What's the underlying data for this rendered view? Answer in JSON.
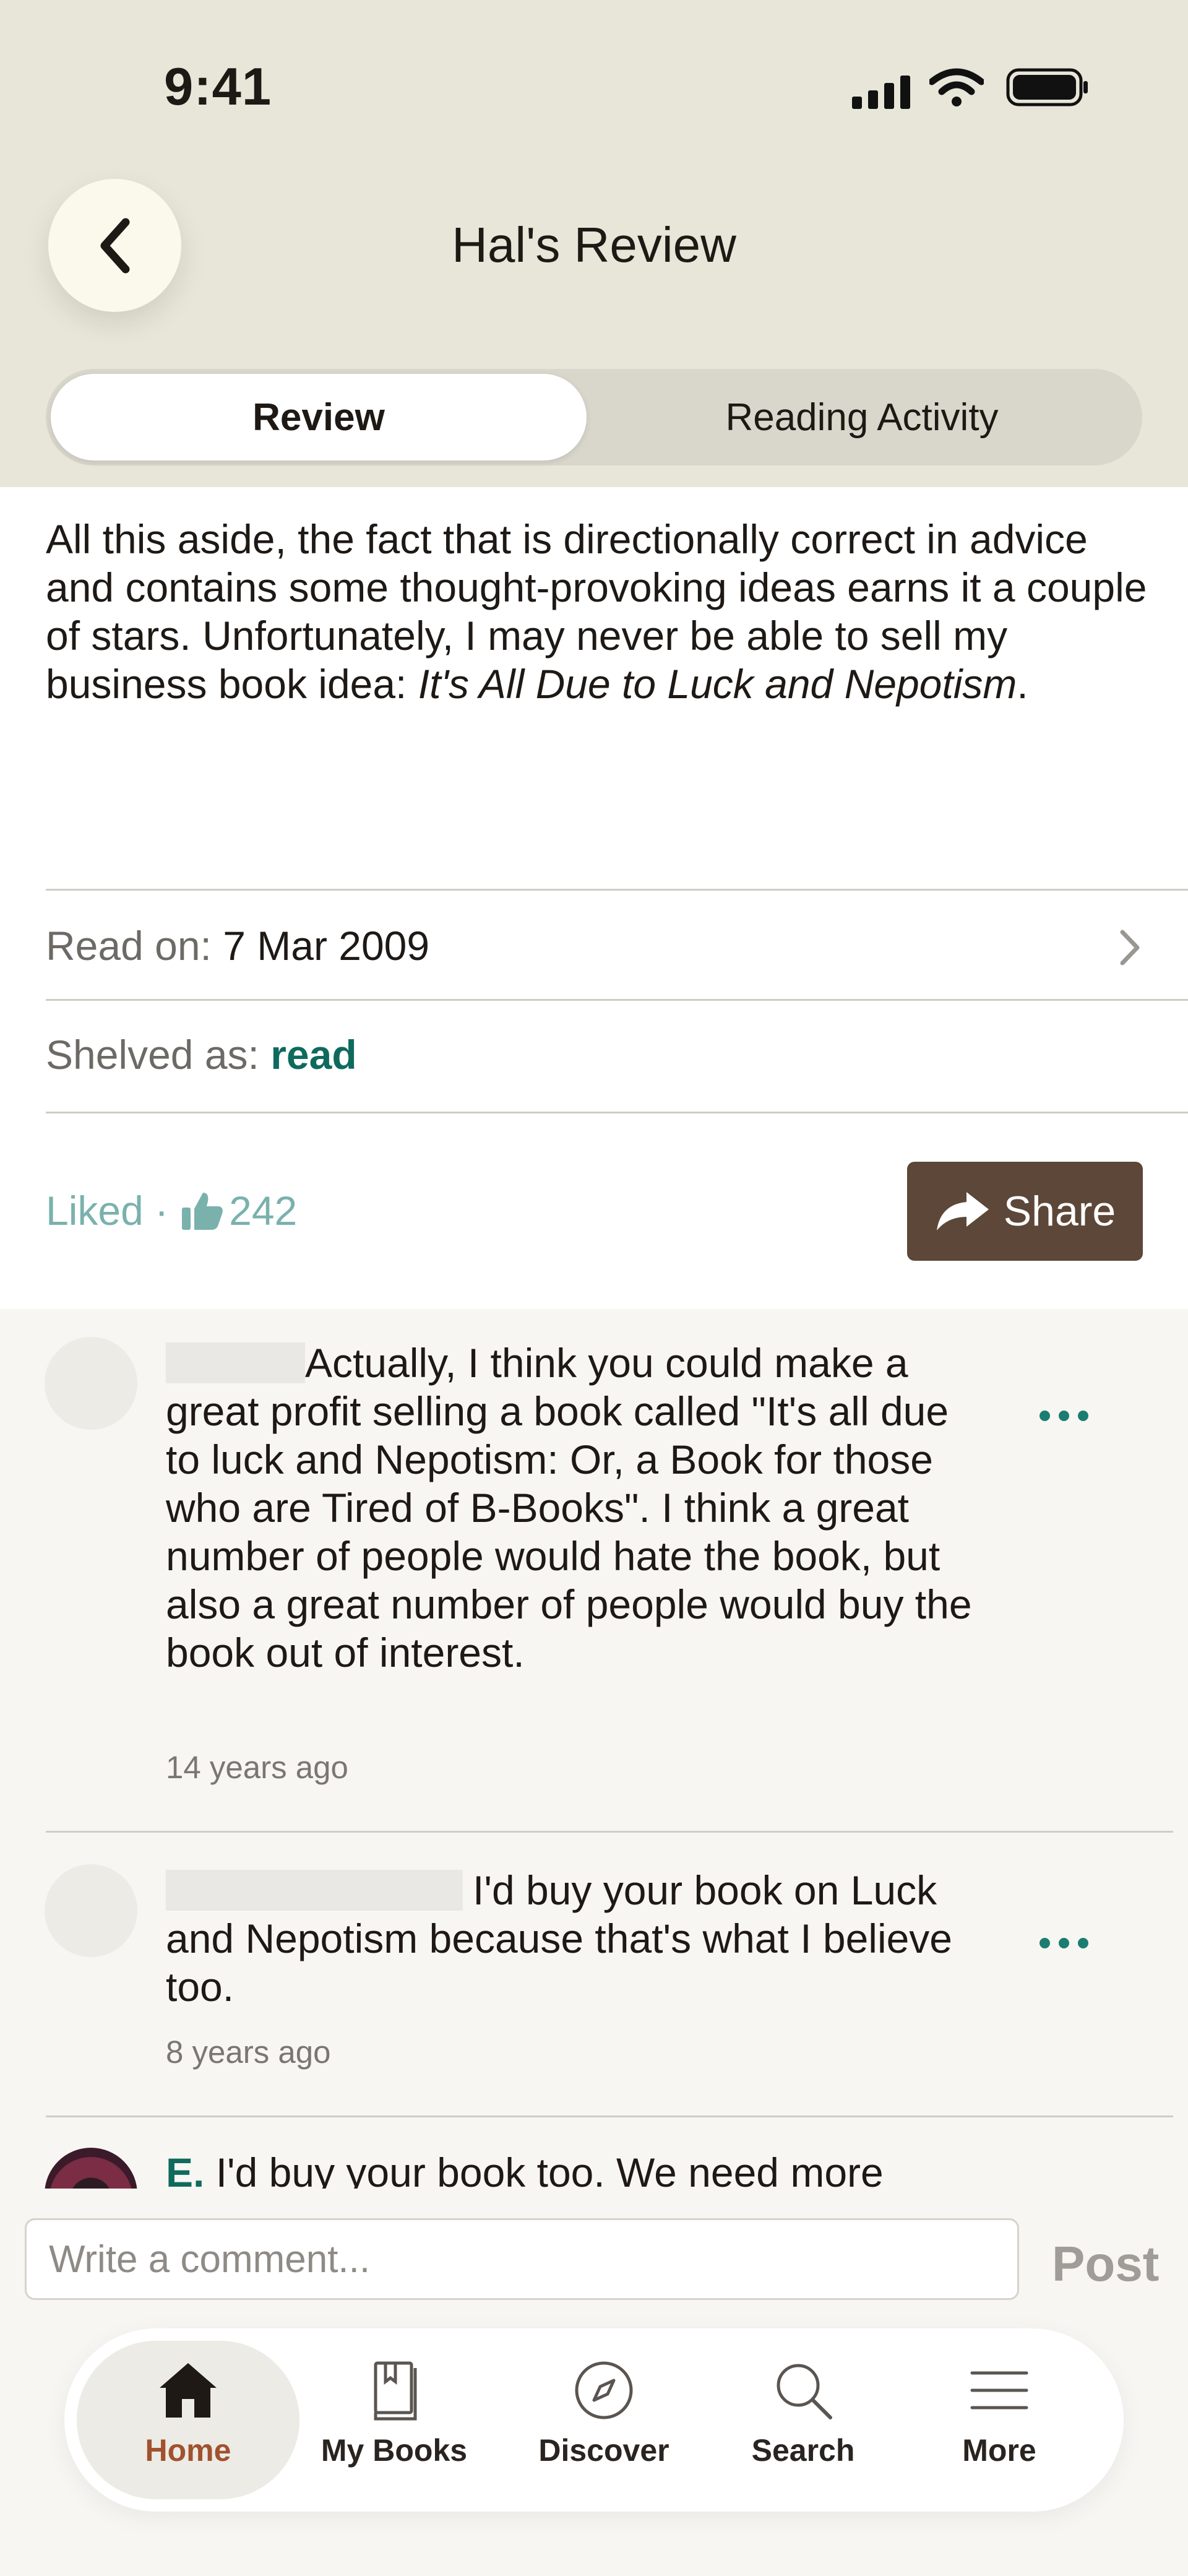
{
  "status_bar": {
    "time": "9:41"
  },
  "header": {
    "title": "Hal's Review"
  },
  "segmented": {
    "review": "Review",
    "activity": "Reading Activity"
  },
  "review": {
    "text_plain": "All this aside, the fact that is directionally correct in advice and contains some thought-provoking ideas earns it a couple of stars. Unfortunately, I may never be able to sell my business book idea: ",
    "text_italic": "It's All Due to Luck and Nepotism",
    "text_end": "."
  },
  "read_on": {
    "label": "Read on:",
    "value": "7 Mar 2009"
  },
  "shelved": {
    "label": "Shelved as:",
    "value": "read"
  },
  "likes": {
    "label": "Liked ·",
    "count": "242"
  },
  "share": {
    "label": "Share"
  },
  "comments": [
    {
      "author": "",
      "text": "Actually, I think you could make a great profit selling a book called \"It's all due to luck and Nepotism: Or, a Book for those who are Tired of B-Books\". I think a great number of people would hate the book, but also a great number of people would buy the book out of interest.",
      "time": "14 years ago"
    },
    {
      "author": "",
      "text": "I'd buy your book on Luck and Nepotism because that's what I believe too.",
      "time": "8 years ago"
    },
    {
      "author": "E.",
      "text": "I'd buy your book too. We need more"
    }
  ],
  "comment_input": {
    "placeholder": "Write a comment...",
    "post": "Post"
  },
  "tabs": [
    {
      "label": "Home",
      "icon": "home-icon"
    },
    {
      "label": "My Books",
      "icon": "book-icon"
    },
    {
      "label": "Discover",
      "icon": "compass-icon"
    },
    {
      "label": "Search",
      "icon": "search-icon"
    },
    {
      "label": "More",
      "icon": "menu-icon"
    }
  ],
  "colors": {
    "accent_teal": "#0f6a5e",
    "share_brown": "#5c4738",
    "header_bg": "#e8e6d9",
    "home_active": "#a0522d"
  }
}
